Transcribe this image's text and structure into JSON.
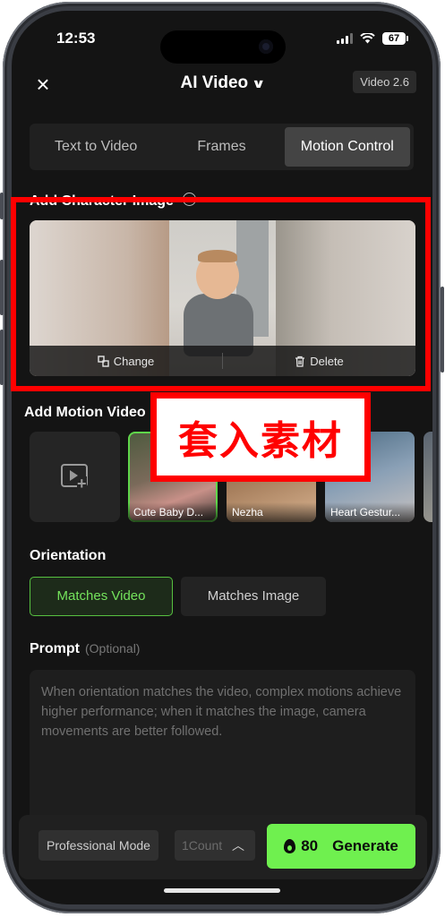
{
  "status_bar": {
    "time": "12:53",
    "battery": "67"
  },
  "header": {
    "close_icon": "×",
    "title": "AI Video",
    "chevron_icon": "∨",
    "version": "Video 2.6"
  },
  "tabs": [
    {
      "label": "Text to Video",
      "active": false
    },
    {
      "label": "Frames",
      "active": false
    },
    {
      "label": "Motion Control",
      "active": true
    }
  ],
  "character_section": {
    "label": "Add Character Image",
    "change_label": "Change",
    "delete_label": "Delete"
  },
  "motion_section": {
    "label": "Add Motion Video",
    "videos": [
      {
        "label": "Cute Baby D...",
        "selected": true
      },
      {
        "label": "Nezha",
        "selected": false
      },
      {
        "label": "Heart Gestur...",
        "selected": false
      }
    ]
  },
  "overlay": {
    "text": "套入素材",
    "color": "#ff0000"
  },
  "orientation": {
    "label": "Orientation",
    "options": [
      {
        "label": "Matches Video",
        "selected": true
      },
      {
        "label": "Matches Image",
        "selected": false
      }
    ]
  },
  "prompt": {
    "label": "Prompt",
    "optional": "(Optional)",
    "placeholder": "When orientation matches the video, complex motions achieve higher performance; when it matches the image, camera movements are better followed."
  },
  "bottom": {
    "mode": "Professional Mode",
    "count": "1Count",
    "credits": "80",
    "generate": "Generate"
  },
  "colors": {
    "accent_green": "#6ff04f",
    "selected_green": "#74e35c",
    "annotation_red": "#ff0000"
  }
}
